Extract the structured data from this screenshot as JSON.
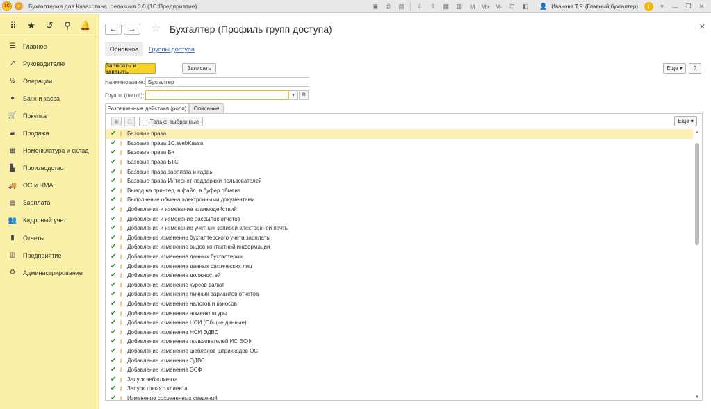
{
  "titlebar": {
    "logo_text": "1С",
    "app_title": "Бухгалтерия для Казахстана, редакция 3.0  (1С:Предприятие)",
    "memory_labels": [
      "M",
      "M+",
      "M-"
    ],
    "user": "Иванова Т.Р. (Главный бухгалтер)",
    "info_label": "i"
  },
  "sidebar": {
    "items": [
      {
        "label": "Главное",
        "icon": "☰"
      },
      {
        "label": "Руководителю",
        "icon": "↗"
      },
      {
        "label": "Операции",
        "icon": "½"
      },
      {
        "label": "Банк и касса",
        "icon": "●"
      },
      {
        "label": "Покупка",
        "icon": "🛒"
      },
      {
        "label": "Продажа",
        "icon": "▰"
      },
      {
        "label": "Номенклатура и склад",
        "icon": "▦"
      },
      {
        "label": "Производство",
        "icon": "▙"
      },
      {
        "label": "ОС и НМА",
        "icon": "🚚"
      },
      {
        "label": "Зарплата",
        "icon": "▤"
      },
      {
        "label": "Кадровый учет",
        "icon": "👥"
      },
      {
        "label": "Отчеты",
        "icon": "▮"
      },
      {
        "label": "Предприятие",
        "icon": "▥"
      },
      {
        "label": "Администрирование",
        "icon": "⚙"
      }
    ]
  },
  "form": {
    "title": "Бухгалтер (Профиль групп доступа)",
    "tabs": [
      "Основное",
      "Группы доступа"
    ],
    "save_close": "Записать и закрыть",
    "save": "Записать",
    "more": "Еще",
    "help": "?",
    "name_label": "Наименование:",
    "name_value": "Бухгалтер",
    "group_label": "Группа (папка):",
    "group_value": "",
    "subtabs": [
      "Разрешенные действия (роли)",
      "Описание"
    ],
    "only_selected": "Только выбранные",
    "list_more": "Еще"
  },
  "roles": [
    "Базовые права",
    "Базовые права 1С:WebKassa",
    "Базовые права БК",
    "Базовые права БТС",
    "Базовые права зарплата и кадры",
    "Базовые права Интернет-поддержки пользователей",
    "Вывод на принтер, в файл, в буфер обмена",
    "Выполнение обмена электронными документами",
    "Добавление и изменение взаимодействий",
    "Добавление и изменение рассылок отчетов",
    "Добавление и изменение учетных записей электронной почты",
    "Добавление изменение бухгалтерского учета зарплаты",
    "Добавление изменение видов контактной информации",
    "Добавление изменение данных бухгалтерии",
    "Добавление изменение данных физических лиц",
    "Добавление изменение должностей",
    "Добавление изменение курсов валют",
    "Добавление изменение личных вариантов отчетов",
    "Добавление изменение налогов и взносов",
    "Добавление изменение номенклатуры",
    "Добавление изменение НСИ (Общие данные)",
    "Добавление изменение НСИ ЭДВС",
    "Добавление изменение пользователей ИС ЭСФ",
    "Добавление изменение шаблонов штрихкодов ОС",
    "Добавление изменение ЭДВС",
    "Добавление изменение ЭСФ",
    "Запуск веб-клиента",
    "Запуск тонкого клиента",
    "Изменение сохраненных сведений"
  ],
  "colors": {
    "sidebar_bg": "#faf0a8",
    "accent_yellow": "#f7d328",
    "link": "#3b6bb0",
    "check": "#2c8a2c",
    "key": "#d4a21d"
  }
}
